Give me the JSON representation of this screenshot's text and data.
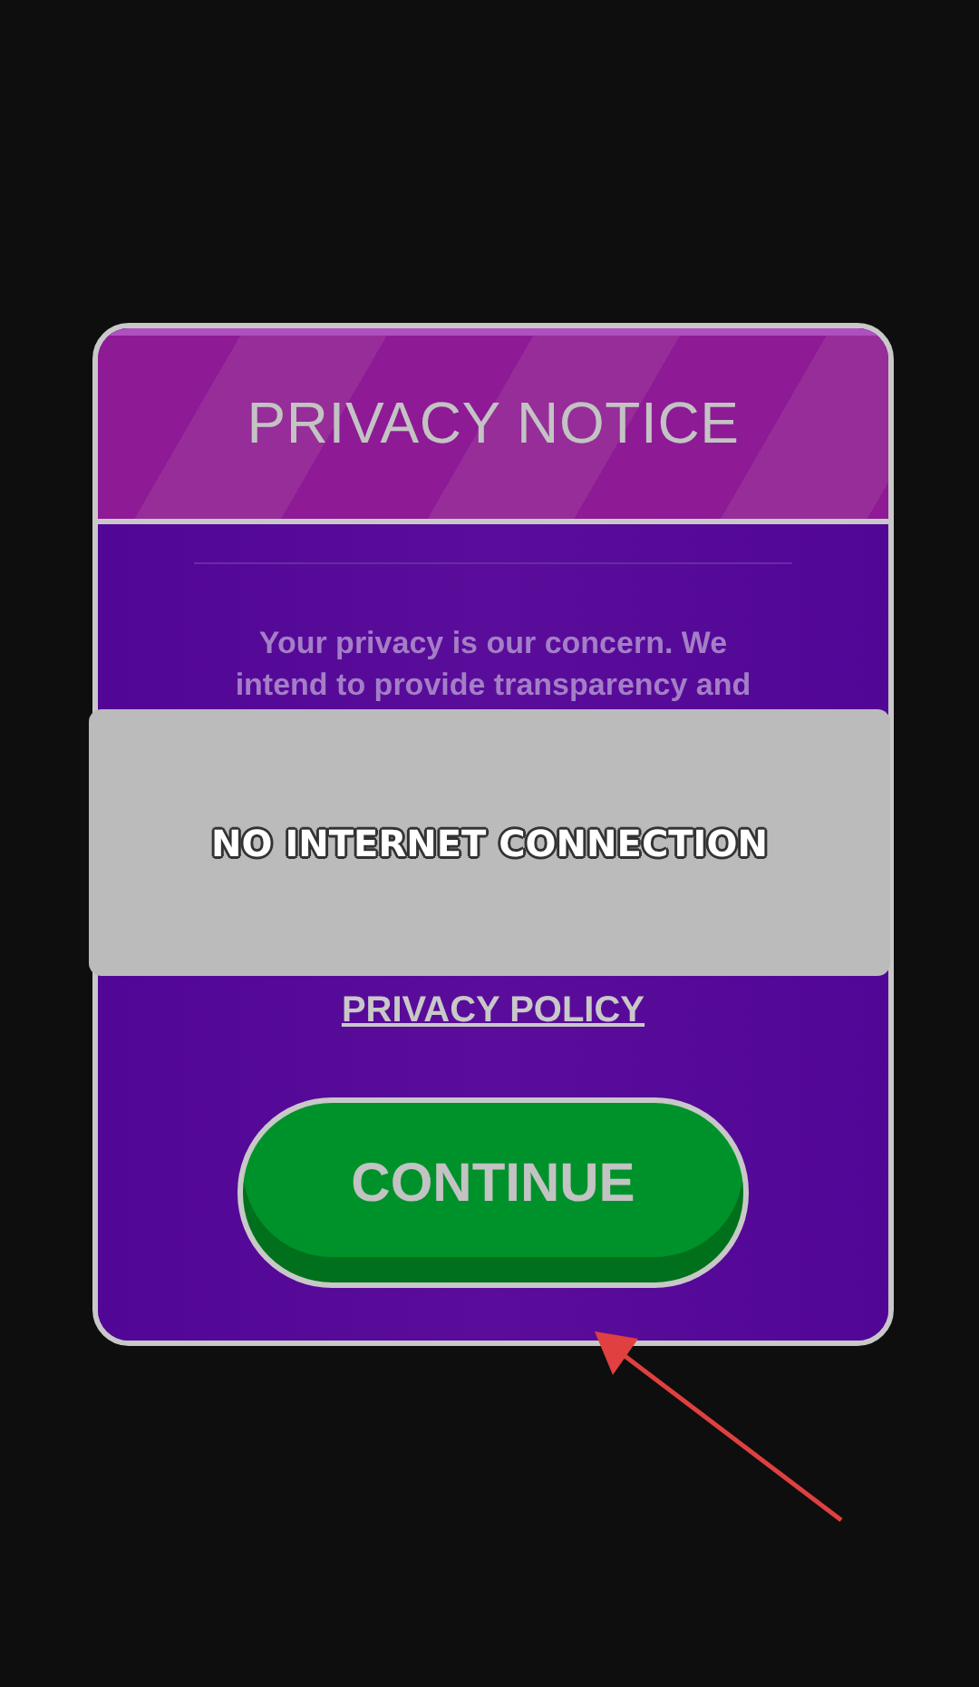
{
  "dialog": {
    "title": "PRIVACY NOTICE",
    "body_lines": [
      "Your privacy is our concern. We",
      "intend to provide transparency and"
    ],
    "link": "PRIVACY POLICY",
    "button": "CONTINUE"
  },
  "toast": {
    "message": "NO INTERNET CONNECTION"
  }
}
